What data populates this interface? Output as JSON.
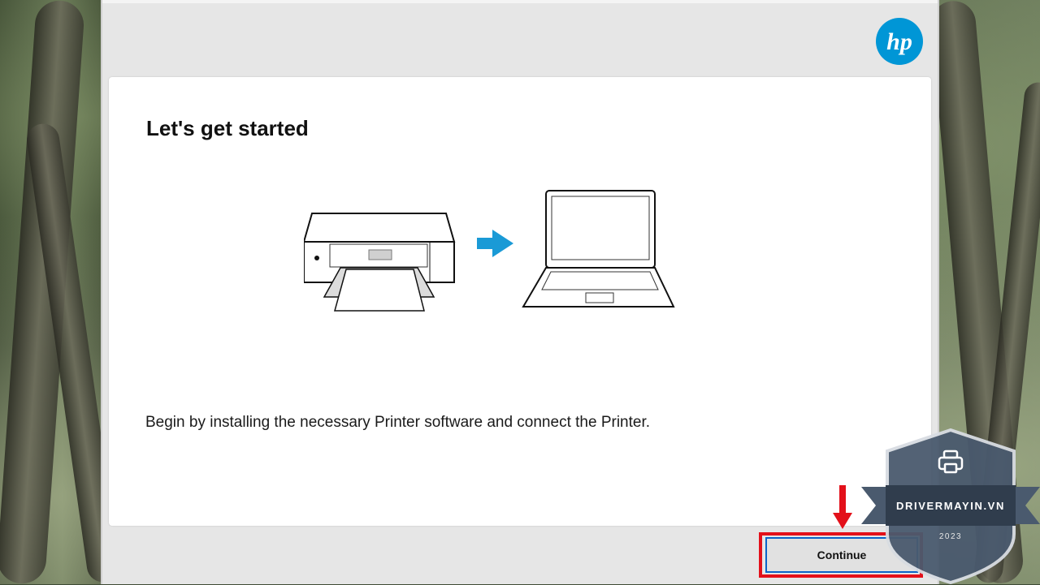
{
  "installer": {
    "logo": "hp",
    "title": "Let's get started",
    "description": "Begin by installing the necessary Printer software and connect the Printer.",
    "continue_label": "Continue"
  },
  "illustration": {
    "printer": "printer-icon",
    "arrow": "arrow-right-icon",
    "laptop": "laptop-icon",
    "arrow_color": "#1a9ad6"
  },
  "watermark": {
    "site": "DRIVERMAYIN.VN",
    "year": "2023",
    "icon": "printer-icon"
  },
  "colors": {
    "hp_blue": "#0096d6",
    "highlight_red": "#e3101a",
    "button_border": "#0a64c8"
  }
}
